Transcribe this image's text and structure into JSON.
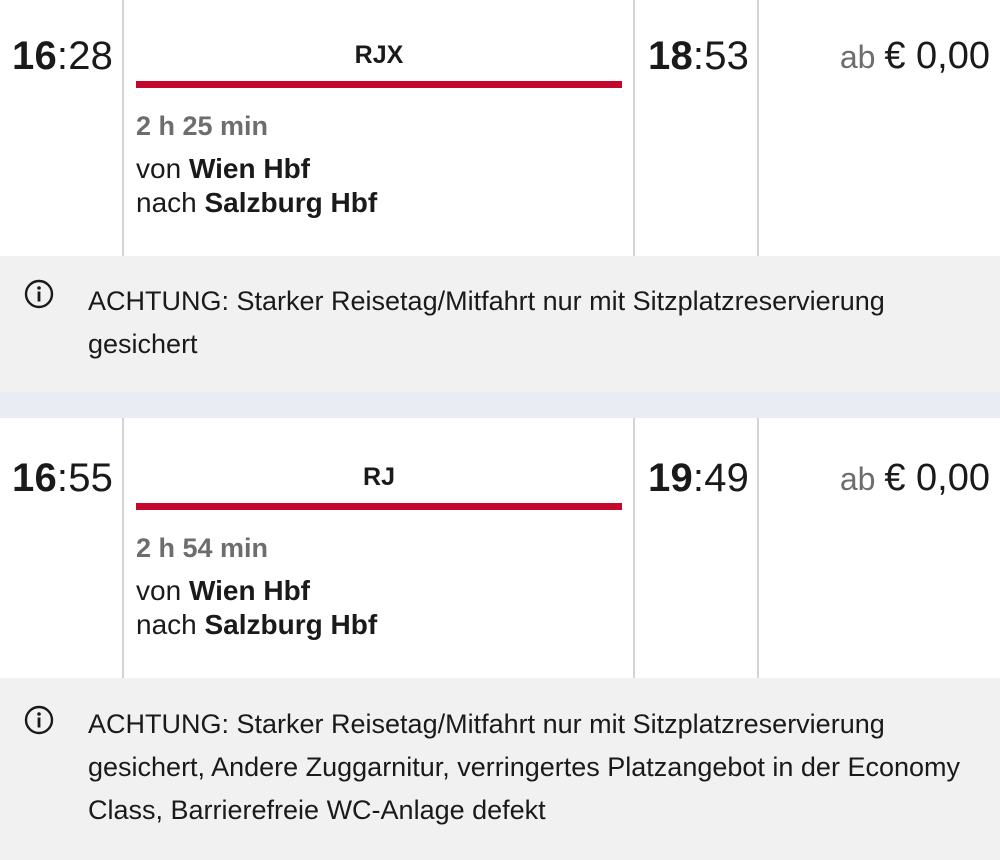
{
  "connections": [
    {
      "departure_hour": "16",
      "departure_min": ":28",
      "train": "RJX",
      "arrival_hour": "18",
      "arrival_min": ":53",
      "duration": "2 h 25 min",
      "from_prefix": "von ",
      "from_station": "Wien Hbf",
      "to_prefix": "nach ",
      "to_station": "Salzburg Hbf",
      "price_prefix": "ab ",
      "price": "€ 0,00",
      "notice": "ACHTUNG: Starker Reisetag/Mitfahrt nur mit Sitzplatzreservierung gesichert"
    },
    {
      "departure_hour": "16",
      "departure_min": ":55",
      "train": "RJ",
      "arrival_hour": "19",
      "arrival_min": ":49",
      "duration": "2 h 54 min",
      "from_prefix": "von ",
      "from_station": "Wien Hbf",
      "to_prefix": "nach ",
      "to_station": "Salzburg Hbf",
      "price_prefix": "ab ",
      "price": "€ 0,00",
      "notice": "ACHTUNG: Starker Reisetag/Mitfahrt nur mit Sitzplatzreservierung gesichert, Andere Zuggarnitur, verringertes Platzangebot in der Economy Class, Barrierefreie WC-Anlage defekt"
    }
  ],
  "colors": {
    "accent": "#c3082c",
    "notice_bg": "#f1f1f1",
    "muted": "#6d6d6d"
  },
  "icons": {
    "info": "info-icon"
  }
}
